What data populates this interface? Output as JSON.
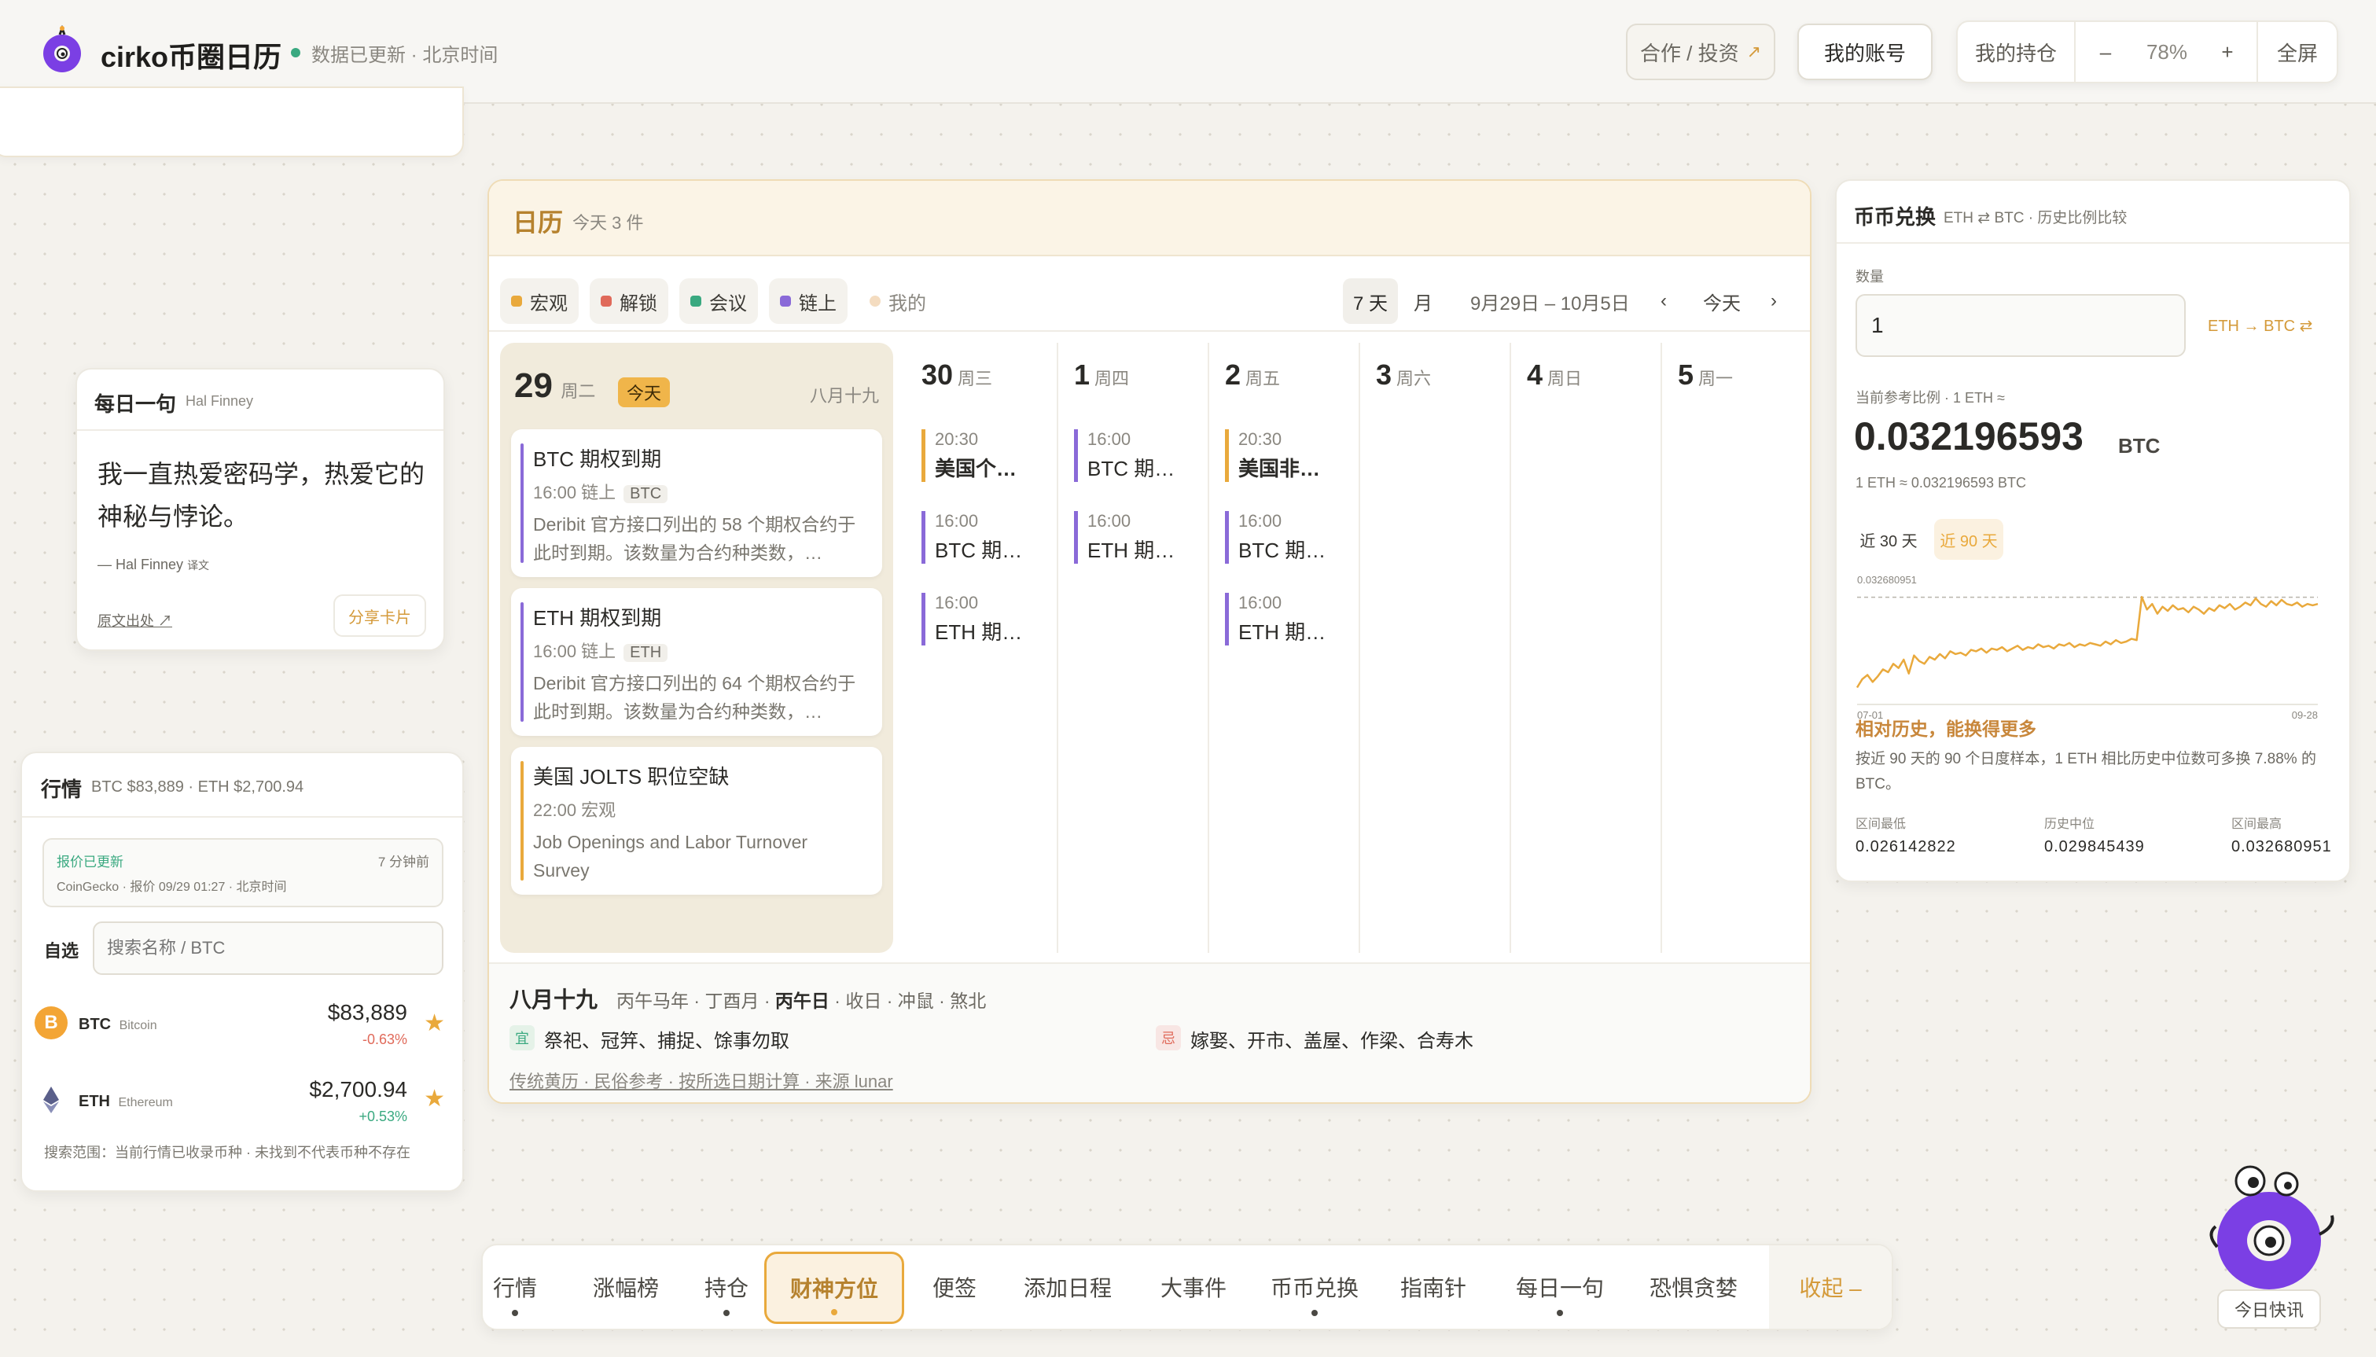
{
  "header": {
    "app_title": "cirko币圈日历",
    "status": "数据已更新 · 北京时间",
    "coop_label": "合作 / 投资",
    "coop_arrow": "↗",
    "account_label": "我的账号",
    "holdings_label": "我的持仓",
    "zoom_minus": "–",
    "zoom_value": "78%",
    "zoom_plus": "+",
    "fullscreen_label": "全屏"
  },
  "quote": {
    "title": "每日一句",
    "author_tag": "Hal Finney",
    "text": "我一直热爱密码学，热爱它的神秘与悖论。",
    "by": "— Hal Finney",
    "by_note": "译文",
    "source_link": "原文出处 ↗",
    "share_label": "分享卡片"
  },
  "market": {
    "title": "行情",
    "summary": "BTC $83,889 · ETH $2,700.94",
    "status_title": "报价已更新",
    "status_detail": "CoinGecko · 报价 09/29 01:27 · 北京时间",
    "updated_ago": "7 分钟前",
    "watch_label": "自选",
    "search_placeholder": "搜索名称 / BTC",
    "coins": [
      {
        "symbol": "BTC",
        "name": "Bitcoin",
        "price": "$83,889",
        "change": "-0.63%",
        "icon": "B"
      },
      {
        "symbol": "ETH",
        "name": "Ethereum",
        "price": "$2,700.94",
        "change": "+0.53%",
        "icon": "eth-diamond-icon"
      }
    ],
    "footnote": "搜索范围：当前行情已收录币种 · 未找到不代表币种不存在",
    "colors": {
      "up": "#3aa980",
      "down": "#e06a5a",
      "star": "#e9a93c"
    }
  },
  "calendar": {
    "title": "日历",
    "subtitle": "今天 3 件",
    "filters": [
      {
        "label": "宏观",
        "color": "#e9a93c"
      },
      {
        "label": "解锁",
        "color": "#e06a5a"
      },
      {
        "label": "会议",
        "color": "#3aa980"
      },
      {
        "label": "链上",
        "color": "#8a6ad8"
      },
      {
        "label": "我的",
        "color": "#f4dcc0"
      }
    ],
    "view_week": "7 天",
    "view_month": "月",
    "range": "9月29日 – 10月5日",
    "prev": "‹",
    "today": "今天",
    "next": "›",
    "today_col": {
      "day": "29",
      "weekday": "周二",
      "badge": "今天",
      "lunar": "八月十九",
      "events": [
        {
          "title": "BTC 期权到期",
          "time": "16:00 链上",
          "tag": "BTC",
          "desc": "Deribit 官方接口列出的 58 个期权合约于此时到期。该数量为合约种类数，…"
        },
        {
          "title": "ETH 期权到期",
          "time": "16:00 链上",
          "tag": "ETH",
          "desc": "Deribit 官方接口列出的 64 个期权合约于此时到期。该数量为合约种类数，…"
        },
        {
          "title": "美国 JOLTS 职位空缺",
          "time": "22:00 宏观",
          "desc": "Job Openings and Labor Turnover Survey"
        }
      ]
    },
    "days": [
      {
        "day": "30",
        "weekday": "周三",
        "events": [
          {
            "time": "20:30",
            "title": "美国个…",
            "kind": "macro"
          },
          {
            "time": "16:00",
            "title": "BTC 期…",
            "kind": "chain"
          },
          {
            "time": "16:00",
            "title": "ETH 期…",
            "kind": "chain"
          }
        ]
      },
      {
        "day": "1",
        "weekday": "周四",
        "events": [
          {
            "time": "16:00",
            "title": "BTC 期…",
            "kind": "chain"
          },
          {
            "time": "16:00",
            "title": "ETH 期…",
            "kind": "chain"
          }
        ]
      },
      {
        "day": "2",
        "weekday": "周五",
        "events": [
          {
            "time": "20:30",
            "title": "美国非…",
            "kind": "macro"
          },
          {
            "time": "16:00",
            "title": "BTC 期…",
            "kind": "chain"
          },
          {
            "time": "16:00",
            "title": "ETH 期…",
            "kind": "chain"
          }
        ]
      },
      {
        "day": "3",
        "weekday": "周六",
        "events": []
      },
      {
        "day": "4",
        "weekday": "周日",
        "events": []
      },
      {
        "day": "5",
        "weekday": "周一",
        "events": []
      }
    ],
    "lunar_footer": {
      "date": "八月十九",
      "ganzhi_prefix": "丙午马年 · 丁酉月 ·",
      "ganzhi_day": "丙午日",
      "ganzhi_suffix": "· 收日 · 冲鼠 · 煞北",
      "yi_icon": "宜",
      "yi": "祭祀、冠笄、捕捉、馀事勿取",
      "ji_icon": "忌",
      "ji": "嫁娶、开市、盖屋、作梁、合寿木",
      "note": "传统黄历 · 民俗参考 · 按所选日期计算 · 来源 lunar"
    }
  },
  "exchange": {
    "title": "币币兑换",
    "subtitle": "ETH ⇄ BTC · 历史比例比较",
    "qty_label": "数量",
    "qty_value": "1",
    "direction": "ETH → BTC ⇄",
    "rate_label": "当前参考比例 · 1 ETH ≈",
    "rate": "0.032196593",
    "rate_unit": "BTC",
    "rate_line": "1 ETH ≈ 0.032196593 BTC",
    "tab_30": "近 30 天",
    "tab_90": "近 90 天",
    "headline": "相对历史，能换得更多",
    "paragraph": "按近 90 天的 90 个日度样本，1 ETH 相比历史中位数可多换 7.88% 的 BTC。",
    "stats": [
      {
        "label": "区间最低",
        "value": "0.026142822"
      },
      {
        "label": "历史中位",
        "value": "0.029845439"
      },
      {
        "label": "区间最高",
        "value": "0.032680951"
      }
    ]
  },
  "chart_data": {
    "type": "line",
    "title": "",
    "xlabel": "",
    "ylabel": "",
    "x_start_label": "07-01",
    "x_end_label": "09-28",
    "y_ref_label": "0.032680951",
    "y_ref": 0.032680951,
    "ylim": [
      0.026,
      0.033
    ],
    "grid": false,
    "color": "#e9a93c",
    "series": [
      {
        "values": [
          0.0262,
          0.0268,
          0.0271,
          0.0266,
          0.027,
          0.0275,
          0.0273,
          0.0279,
          0.0276,
          0.0282,
          0.0272,
          0.0285,
          0.0281,
          0.0279,
          0.0284,
          0.0282,
          0.0286,
          0.0283,
          0.0288,
          0.0286,
          0.0287,
          0.0285,
          0.0289,
          0.0288,
          0.029,
          0.0287,
          0.029,
          0.0289,
          0.0291,
          0.0288,
          0.029,
          0.0292,
          0.0289,
          0.0291,
          0.029,
          0.0293,
          0.0291,
          0.0292,
          0.029,
          0.0293,
          0.0292,
          0.0294,
          0.0291,
          0.0293,
          0.0292,
          0.0294,
          0.0293,
          0.0292,
          0.0295,
          0.0293,
          0.0296,
          0.0294,
          0.0295,
          0.0297,
          0.0296,
          0.0327,
          0.0318,
          0.0322,
          0.0315,
          0.032,
          0.0317,
          0.0321,
          0.0318,
          0.0319,
          0.0316,
          0.032,
          0.0318,
          0.0315,
          0.0319,
          0.0317,
          0.0321,
          0.0319,
          0.0322,
          0.0318,
          0.032,
          0.0323,
          0.0321,
          0.0326,
          0.0322,
          0.032,
          0.0324,
          0.0321,
          0.0325,
          0.0322,
          0.0321,
          0.0323,
          0.032,
          0.0322,
          0.0321,
          0.0322
        ]
      }
    ]
  },
  "bottom_nav": {
    "items": [
      {
        "label": "行情",
        "dot": true
      },
      {
        "label": "涨幅榜",
        "dot": false
      },
      {
        "label": "持仓",
        "dot": true
      },
      {
        "label": "财神方位",
        "dot": true,
        "active": true
      },
      {
        "label": "便签",
        "dot": false
      },
      {
        "label": "添加日程",
        "dot": false
      },
      {
        "label": "大事件",
        "dot": false
      },
      {
        "label": "币币兑换",
        "dot": true
      },
      {
        "label": "指南针",
        "dot": false
      },
      {
        "label": "每日一句",
        "dot": true
      },
      {
        "label": "恐惧贪婪",
        "dot": false
      }
    ],
    "collapse_label": "收起 –"
  },
  "quick_news_label": "今日快讯"
}
